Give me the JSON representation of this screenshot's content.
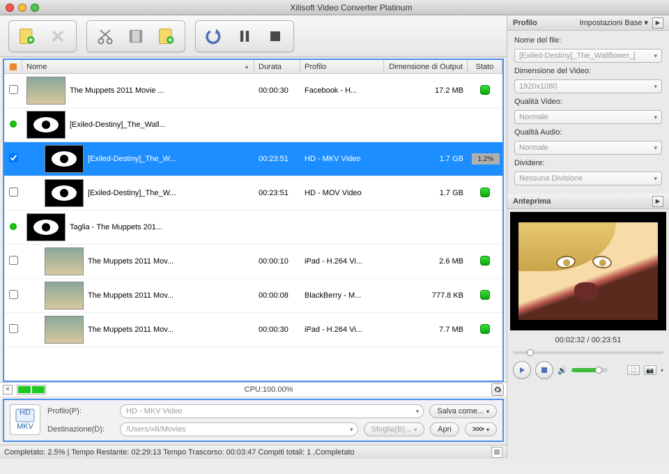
{
  "title": "Xilisoft Video Converter Platinum",
  "columns": {
    "name": "Nome",
    "duration": "Durata",
    "profile": "Profilo",
    "outputSize": "Dimensione di Output",
    "status": "Stato"
  },
  "rows": [
    {
      "checked": false,
      "indent": 0,
      "thumb": "scene",
      "name": "The Muppets 2011 Movie ...",
      "dur": "00:00:30",
      "prof": "Facebook - H...",
      "size": "17.2 MB",
      "status": "ok"
    },
    {
      "checked": false,
      "indent": 0,
      "green": true,
      "thumb": "eye",
      "name": "[Exiled-Destiny]_The_Wall...",
      "dur": "",
      "prof": "",
      "size": "",
      "status": ""
    },
    {
      "checked": true,
      "indent": 1,
      "selected": true,
      "thumb": "eye",
      "name": "[Exiled-Destiny]_The_W...",
      "dur": "00:23:51",
      "prof": "HD - MKV Video",
      "size": "1.7 GB",
      "status": "progress",
      "progress": "1.2%"
    },
    {
      "checked": false,
      "indent": 1,
      "thumb": "eye",
      "name": "[Exiled-Destiny]_The_W...",
      "dur": "00:23:51",
      "prof": "HD - MOV Video",
      "size": "1.7 GB",
      "status": "ok"
    },
    {
      "checked": false,
      "indent": 0,
      "green": true,
      "thumb": "eye",
      "name": "Taglia - The Muppets 201...",
      "dur": "",
      "prof": "",
      "size": "",
      "status": ""
    },
    {
      "checked": false,
      "indent": 1,
      "thumb": "scene",
      "name": "The Muppets 2011 Mov...",
      "dur": "00:00:10",
      "prof": "iPad - H.264 Vi...",
      "size": "2.6 MB",
      "status": "ok"
    },
    {
      "checked": false,
      "indent": 1,
      "thumb": "scene",
      "name": "The Muppets 2011 Mov...",
      "dur": "00:00:08",
      "prof": "BlackBerry - M...",
      "size": "777.8 KB",
      "status": "ok"
    },
    {
      "checked": false,
      "indent": 1,
      "thumb": "scene",
      "name": "The Muppets 2011 Mov...",
      "dur": "00:00:30",
      "prof": "iPad - H.264 Vi...",
      "size": "7.7 MB",
      "status": "ok"
    }
  ],
  "cpu": "CPU:100.00%",
  "bottom": {
    "iconText": "MKV",
    "profileLabel": "Profilo(P):",
    "profileValue": "HD - MKV Video",
    "saveAs": "Salva come...",
    "destLabel": "Destinazione(D):",
    "destValue": "/Users/xili/Movies",
    "browse": "Sfoglia(B)...",
    "open": "Apri",
    "send": ">>>"
  },
  "status": "Completato: 2.5% | Tempo Restante: 02:29:13 Tempo Trascorso: 00:03:47 Compiti totali: 1 ,Completato",
  "right": {
    "profileHeader": "Profilo",
    "baseSettings": "Impostazioni Base",
    "fileNameLabel": "Nome del file:",
    "fileNameValue": "[Exiled-Destiny]_The_Wallflower_[",
    "videoSizeLabel": "Dimensione del Video:",
    "videoSizeValue": "1920x1080",
    "videoQualityLabel": "Qualità Video:",
    "videoQualityValue": "Normale",
    "audioQualityLabel": "Qualità Audio:",
    "audioQualityValue": "Normale",
    "splitLabel": "Dividere:",
    "splitValue": "Nessuna Divisione",
    "previewHeader": "Anteprima",
    "previewTime": "00:02:32 / 00:23:51"
  }
}
